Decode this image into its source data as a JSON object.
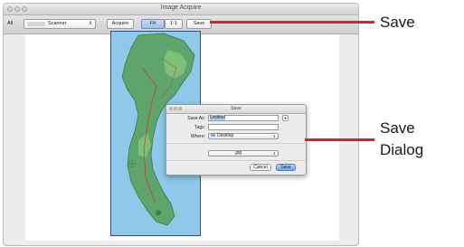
{
  "window": {
    "title": "Image Acquire"
  },
  "toolbar": {
    "source_prefix": "All",
    "source_value": "Scanner",
    "acquire_label": "Acquire",
    "fit_label": "Fit",
    "zoom_label": "1:1",
    "save_label": "Save"
  },
  "dialog": {
    "title": "Save",
    "save_as_label": "Save As:",
    "save_as_value": "Untitled",
    "tags_label": "Tags:",
    "tags_value": "",
    "where_label": "Where:",
    "where_value": "Desktop",
    "format_value": ".jpg",
    "cancel_label": "Cancel",
    "save_label": "Save"
  },
  "callouts": {
    "save": "Save",
    "save_dialog_line1": "Save",
    "save_dialog_line2": "Dialog"
  },
  "colors": {
    "callout_line": "#d9212b",
    "map_water": "#8fc8e8",
    "map_land": "#5fa56b",
    "default_button": "#6aa3eb"
  },
  "icons": {
    "folder": "folder-icon",
    "popup_arrow": "chevron-updown-icon",
    "expand": "chevron-down-icon"
  }
}
